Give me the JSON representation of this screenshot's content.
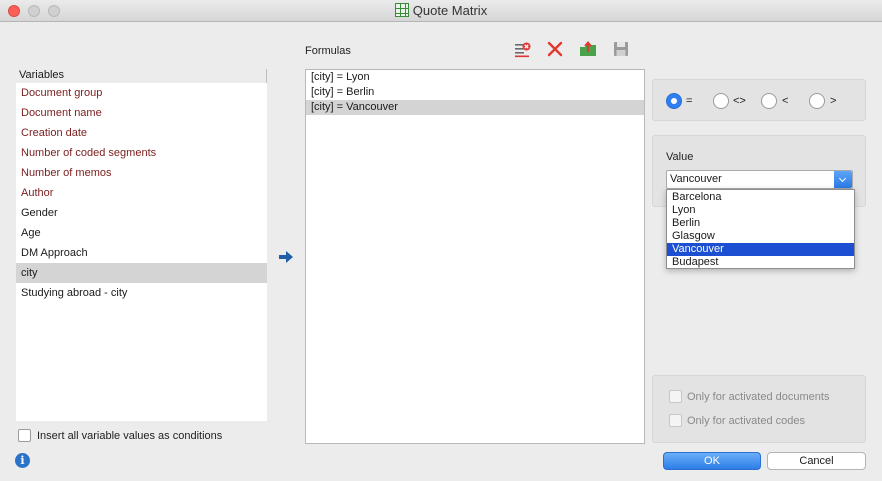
{
  "window": {
    "title": "Quote Matrix"
  },
  "variables": {
    "header": "Variables",
    "items": [
      {
        "label": "Document group",
        "kind": "doc"
      },
      {
        "label": "Document name",
        "kind": "doc"
      },
      {
        "label": "Creation date",
        "kind": "doc"
      },
      {
        "label": "Number of coded segments",
        "kind": "doc"
      },
      {
        "label": "Number of memos",
        "kind": "doc"
      },
      {
        "label": "Author",
        "kind": "doc"
      },
      {
        "label": "Gender",
        "kind": "user"
      },
      {
        "label": "Age",
        "kind": "user"
      },
      {
        "label": "DM Approach",
        "kind": "user"
      },
      {
        "label": "city",
        "kind": "user",
        "selected": true
      },
      {
        "label": "Studying abroad - city",
        "kind": "user"
      }
    ],
    "insert_all_label": "Insert all variable values as conditions"
  },
  "formulas": {
    "label": "Formulas",
    "items": [
      {
        "text": "[city] = Lyon"
      },
      {
        "text": "[city] = Berlin"
      },
      {
        "text": "[city] = Vancouver",
        "selected": true
      }
    ]
  },
  "operators": {
    "items": [
      {
        "symbol": "=",
        "checked": true
      },
      {
        "symbol": "<>",
        "checked": false
      },
      {
        "symbol": "<",
        "checked": false
      },
      {
        "symbol": ">",
        "checked": false
      }
    ]
  },
  "value": {
    "label": "Value",
    "selected": "Vancouver",
    "options": [
      "Barcelona",
      "Lyon",
      "Berlin",
      "Glasgow",
      "Vancouver",
      "Budapest"
    ]
  },
  "options": {
    "activated_documents": "Only for activated documents",
    "activated_codes": "Only for activated codes"
  },
  "buttons": {
    "ok": "OK",
    "cancel": "Cancel"
  },
  "icons": {
    "info": "i",
    "toolbar": [
      "clear-list-icon",
      "delete-icon",
      "export-icon",
      "save-icon"
    ]
  },
  "colors": {
    "doc_variable": "#7b1e1e",
    "accent": "#2f7ff2",
    "dropdown_selected": "#1c4fd1"
  }
}
